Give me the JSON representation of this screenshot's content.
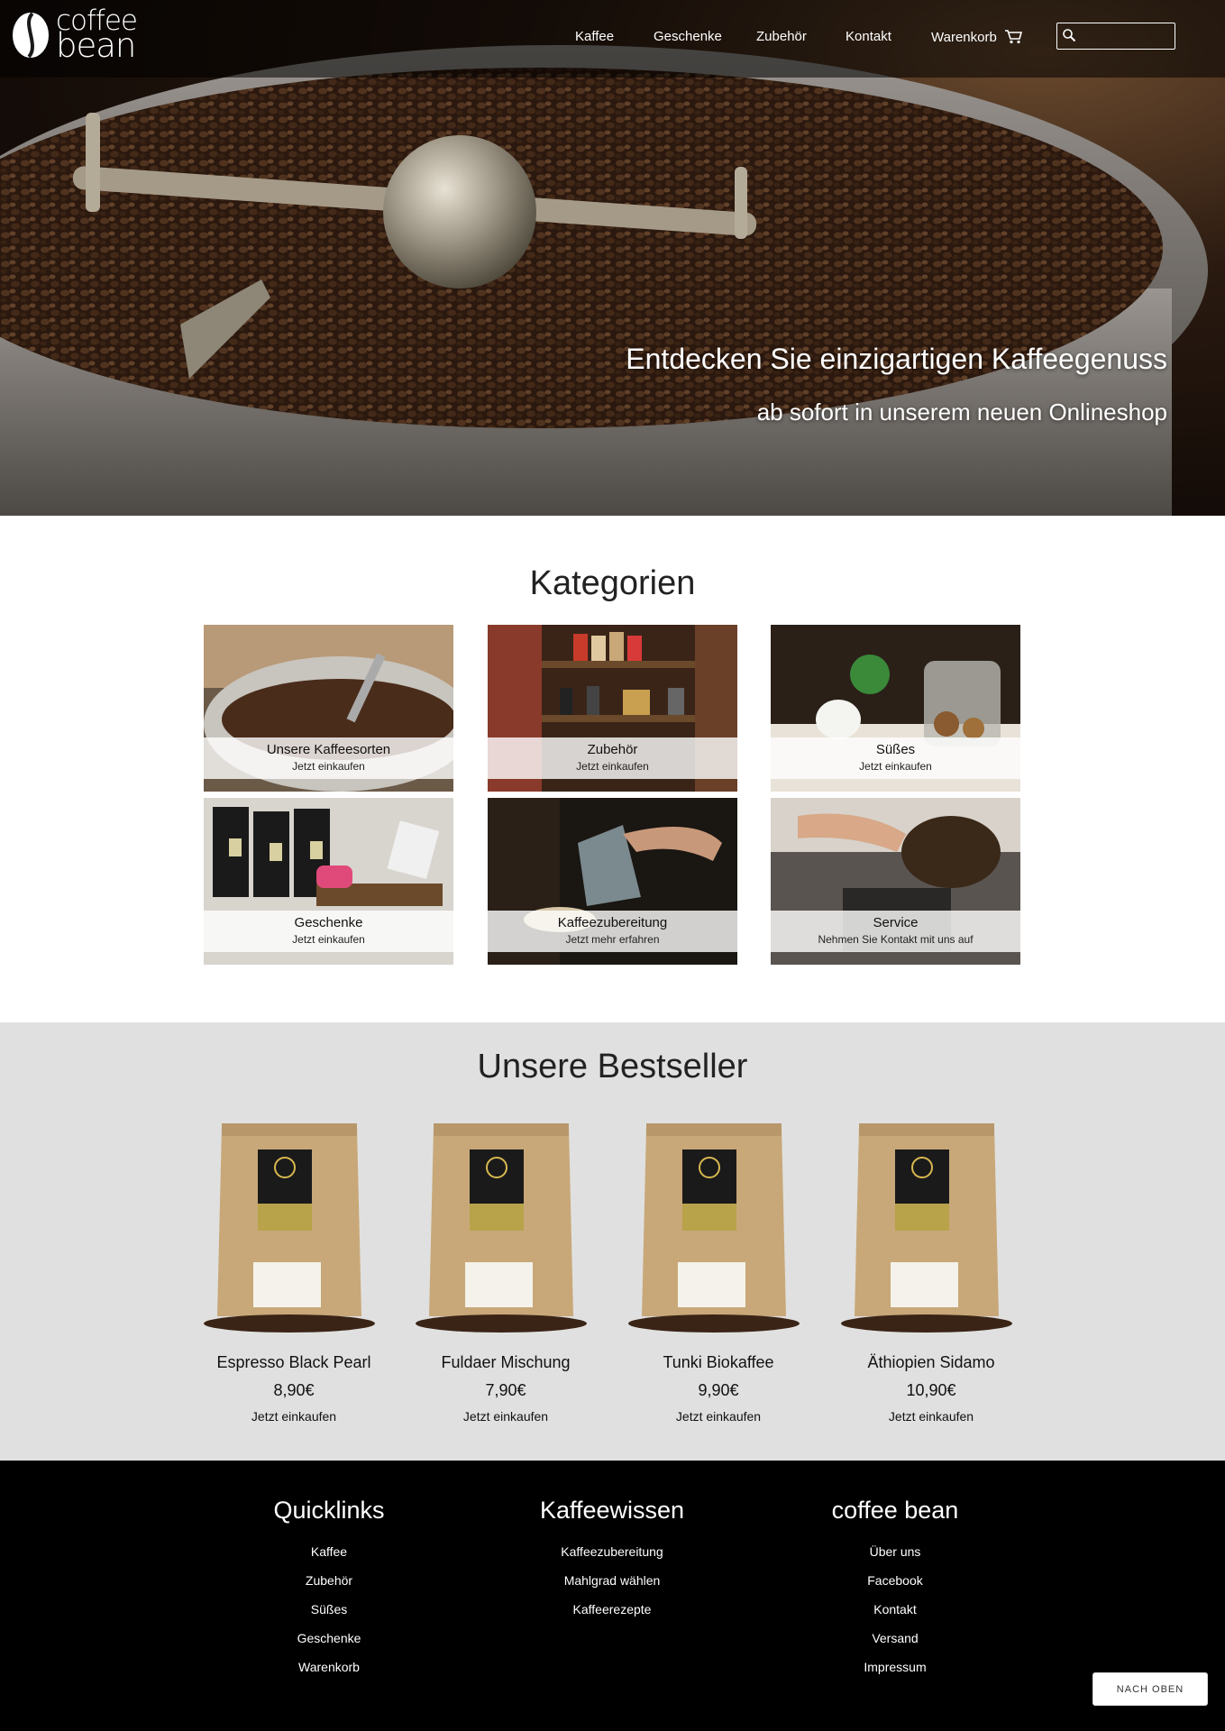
{
  "brand": {
    "line1": "coffee",
    "line2": "bean"
  },
  "nav": {
    "items": [
      "Kaffee",
      "Geschenke",
      "Zubehör",
      "Kontakt"
    ],
    "cart_label": "Warenkorb",
    "search_placeholder": ""
  },
  "hero": {
    "title": "Entdecken Sie einzigartigen Kaffeegenuss",
    "subtitle": "ab sofort in unserem neuen Onlineshop"
  },
  "categories": {
    "title": "Kategorien",
    "items": [
      {
        "name": "Unsere Kaffeesorten",
        "sub": "Jetzt einkaufen"
      },
      {
        "name": "Zubehör",
        "sub": "Jetzt einkaufen"
      },
      {
        "name": "Süßes",
        "sub": "Jetzt einkaufen"
      },
      {
        "name": "Geschenke",
        "sub": "Jetzt einkaufen"
      },
      {
        "name": "Kaffeezubereitung",
        "sub": "Jetzt mehr erfahren"
      },
      {
        "name": "Service",
        "sub": "Nehmen Sie Kontakt mit uns auf"
      }
    ]
  },
  "bestsellers": {
    "title": "Unsere Bestseller",
    "items": [
      {
        "name": "Espresso Black Pearl",
        "price": "8,90€",
        "cta": "Jetzt einkaufen"
      },
      {
        "name": "Fuldaer Mischung",
        "price": "7,90€",
        "cta": "Jetzt einkaufen"
      },
      {
        "name": "Tunki Biokaffee",
        "price": "9,90€",
        "cta": "Jetzt einkaufen"
      },
      {
        "name": "Äthiopien Sidamo",
        "price": "10,90€",
        "cta": "Jetzt einkaufen"
      }
    ]
  },
  "footer": {
    "quicklinks": {
      "title": "Quicklinks",
      "links": [
        "Kaffee",
        "Zubehör",
        "Süßes",
        "Geschenke",
        "Warenkorb"
      ]
    },
    "wissen": {
      "title": "Kaffeewissen",
      "links": [
        "Kaffeezubereitung",
        "Mahlgrad wählen",
        "Kaffeerezepte"
      ]
    },
    "brand": {
      "title": "coffee bean",
      "links": [
        "Über uns",
        "Facebook",
        "Kontakt",
        "Versand",
        "Impressum"
      ]
    },
    "back_to_top": "NACH OBEN"
  },
  "colors": {
    "bestseller_bg": "#e0e0e0",
    "footer_bg": "#000000",
    "bean": "#5a3a22"
  }
}
